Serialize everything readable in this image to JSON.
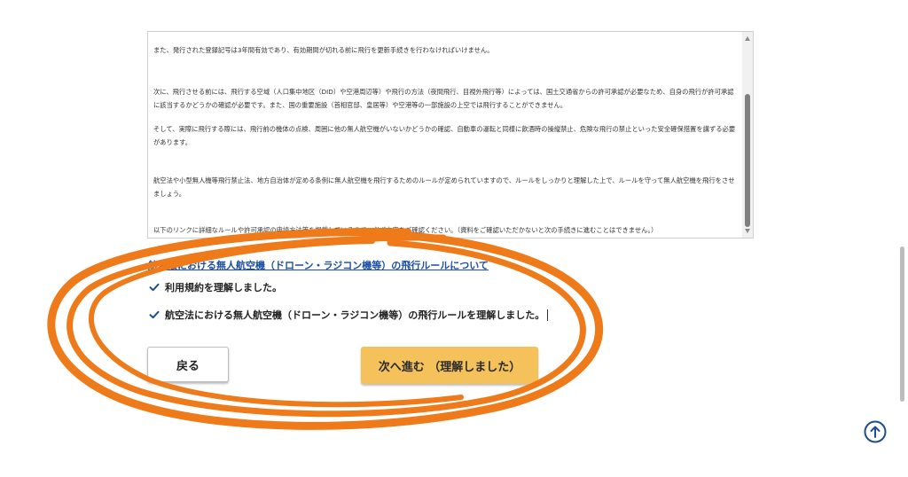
{
  "terms": {
    "p1": "また、発行された登録記号は3年間有効であり、有効期間が切れる前に飛行を更新手続きを行わなければいけません。",
    "p2": "次に、飛行させる前には、飛行する空域（人口集中地区（DID）や空港周辺等）や飛行の方法（夜間飛行、目視外飛行等）によっては、国土交通省からの許可承認が必要なため、自身の飛行が許可承認に該当するかどうかの確認が必要です。また、国の重要施設（首相官邸、皇居等）や空港等の一部施設の上空では飛行することができません。",
    "p3": "そして、実際に飛行する際には、飛行前の機体の点検、周囲に他の無人航空機がいないかどうかの確認、自動車の運転と同様に飲酒時の操縦禁止、危険な飛行の禁止といった安全確保措置を講ずる必要があります。",
    "p4": "航空法や小型無人機等飛行禁止法、地方自治体が定める条例に無人航空機を飛行するためのルールが定められていますので、ルールをしっかりと理解した上で、ルールを守って無人航空機を飛行をさせましょう。",
    "p5": "以下のリンクに詳細なルールや許可承認の申請方法等を掲載しているので、必ず内容をご確認ください。（資料をご確認いただかないと次の手続きに進むことはできません。）"
  },
  "rules_link": "航空法における無人航空機（ドローン・ラジコン機等）の飛行ルールについて",
  "checks": [
    {
      "label": "利用規約を理解しました。",
      "checked": true
    },
    {
      "label": "航空法における無人航空機（ドローン・ラジコン機等）の飛行ルールを理解しました。",
      "checked": true
    }
  ],
  "buttons": {
    "back": "戻る",
    "next": "次へ進む （理解しました）"
  },
  "colors": {
    "accent_link": "#1a4fa3",
    "next_button": "#f4c15a",
    "annotation": "#ef7a1a",
    "check": "#1f4e8c"
  },
  "icons": {
    "check": "check-icon",
    "to_top": "arrow-up-circle-icon"
  }
}
